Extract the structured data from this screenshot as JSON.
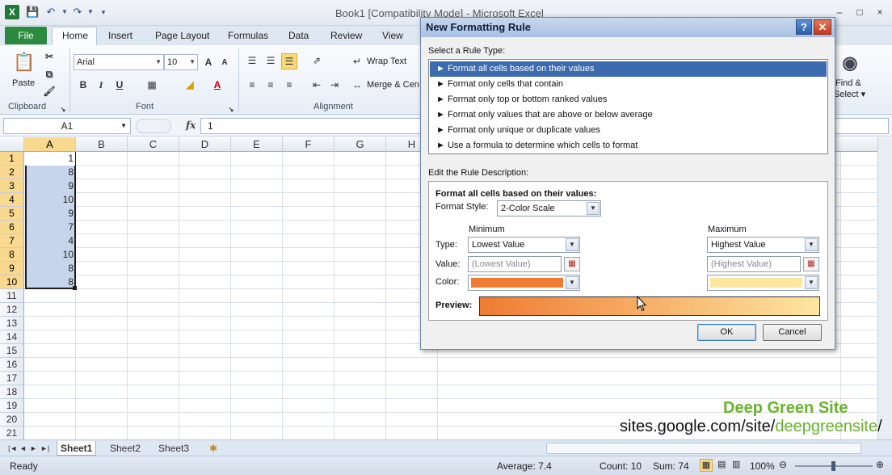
{
  "title_bar": {
    "app_icon_text": "X",
    "title": "Book1  [Compatibility Mode]  -  Microsoft Excel",
    "controls": [
      "–",
      "□",
      "×"
    ]
  },
  "ribbon": {
    "file_tab": "File",
    "tabs": [
      "Home",
      "Insert",
      "Page Layout",
      "Formulas",
      "Data",
      "Review",
      "View"
    ],
    "clipboard": {
      "paste": "Paste",
      "group_label": "Clipboard"
    },
    "font": {
      "name": "Arial",
      "size": "10",
      "bold": "B",
      "italic": "I",
      "underline": "U",
      "group_label": "Font"
    },
    "alignment": {
      "wrap_text": "Wrap Text",
      "merge": "Merge & Cen",
      "group_label": "Alignment"
    },
    "editing": {
      "find_select_line1": "Find &",
      "find_select_line2": "Select ▾"
    }
  },
  "formula_bar": {
    "name_box": "A1",
    "fx": "fx",
    "content": "1"
  },
  "grid": {
    "columns": [
      "A",
      "B",
      "C",
      "D",
      "E",
      "F",
      "G",
      "H"
    ],
    "rows": [
      "1",
      "2",
      "3",
      "4",
      "5",
      "6",
      "7",
      "8",
      "9",
      "10",
      "11",
      "12",
      "13",
      "14",
      "15",
      "16",
      "17",
      "18",
      "19",
      "20",
      "21"
    ],
    "column_a_values": [
      "1",
      "8",
      "9",
      "10",
      "9",
      "7",
      "4",
      "10",
      "8",
      "8"
    ]
  },
  "sheets": {
    "tabs": [
      "Sheet1",
      "Sheet2",
      "Sheet3"
    ]
  },
  "status_bar": {
    "ready": "Ready",
    "average": "Average: 7.4",
    "count": "Count: 10",
    "sum": "Sum: 74",
    "zoom": "100%"
  },
  "watermark": {
    "line1": "Deep Green Site",
    "line2_prefix": "sites.google.com/site/",
    "line2_highlight": "deepgreensite",
    "line2_suffix": "/"
  },
  "dialog": {
    "title": "New Formatting Rule",
    "help": "?",
    "close": "✕",
    "select_rule_label": "Select a Rule Type:",
    "rule_types": [
      "► Format all cells based on their values",
      "► Format only cells that contain",
      "► Format only top or bottom ranked values",
      "► Format only values that are above or below average",
      "► Format only unique or duplicate values",
      "► Use a formula to determine which cells to format"
    ],
    "edit_desc_label": "Edit the Rule Description:",
    "desc_heading": "Format all cells based on their values:",
    "format_style_label": "Format Style:",
    "format_style_value": "2-Color Scale",
    "minimum_label": "Minimum",
    "maximum_label": "Maximum",
    "type_label": "Type:",
    "value_label": "Value:",
    "color_label": "Color:",
    "min_type": "Lowest Value",
    "max_type": "Highest Value",
    "min_value_placeholder": "(Lowest Value)",
    "max_value_placeholder": "(Highest Value)",
    "min_color": "#f07b32",
    "max_color": "#fde6a0",
    "preview_label": "Preview:",
    "ok": "OK",
    "cancel": "Cancel"
  }
}
